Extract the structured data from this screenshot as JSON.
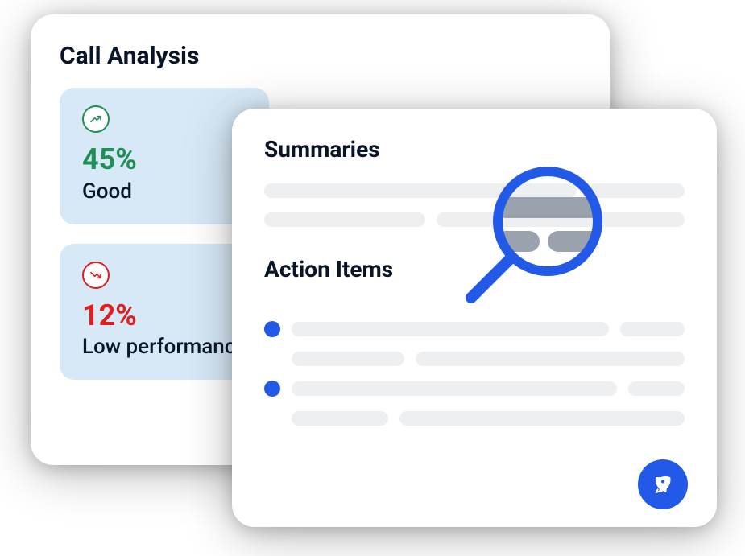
{
  "analysis": {
    "title": "Call Analysis",
    "metrics": [
      {
        "value": "45%",
        "label": "Good",
        "tone": "good"
      },
      {
        "value": "12%",
        "label": "Low performance",
        "tone": "low"
      }
    ]
  },
  "summaries": {
    "title": "Summaries",
    "action_title": "Action Items"
  }
}
